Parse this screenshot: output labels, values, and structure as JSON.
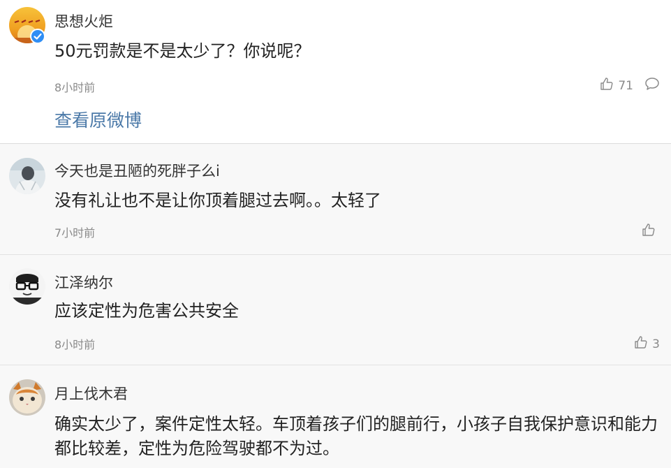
{
  "comments": [
    {
      "username": "思想火炬",
      "content": "50元罚款是不是太少了？你说呢？",
      "time": "8小时前",
      "likes": "71",
      "avatar": "torch-avatar",
      "verified": true,
      "link": "查看原微博"
    },
    {
      "username": "今天也是丑陋的死胖子么i",
      "content": "没有礼让也不是让你顶着腿过去啊。。太轻了",
      "time": "7小时前",
      "likes": "",
      "avatar": "photo-avatar"
    },
    {
      "username": "江泽纳尔",
      "content": "应该定性为危害公共安全",
      "time": "8小时前",
      "likes": "3",
      "avatar": "cartoon-glasses-avatar"
    },
    {
      "username": "月上伐木君",
      "content": "确实太少了，案件定性太轻。车顶着孩子们的腿前行，小孩子自我保护意识和能力都比较差，定性为危险驾驶都不为过。",
      "avatar": "cat-avatar"
    }
  ],
  "colors": {
    "link": "#4b79a8",
    "verified": "#2f8ef5",
    "meta": "#8a8a8a",
    "reply_bg": "#f8f8f8"
  }
}
